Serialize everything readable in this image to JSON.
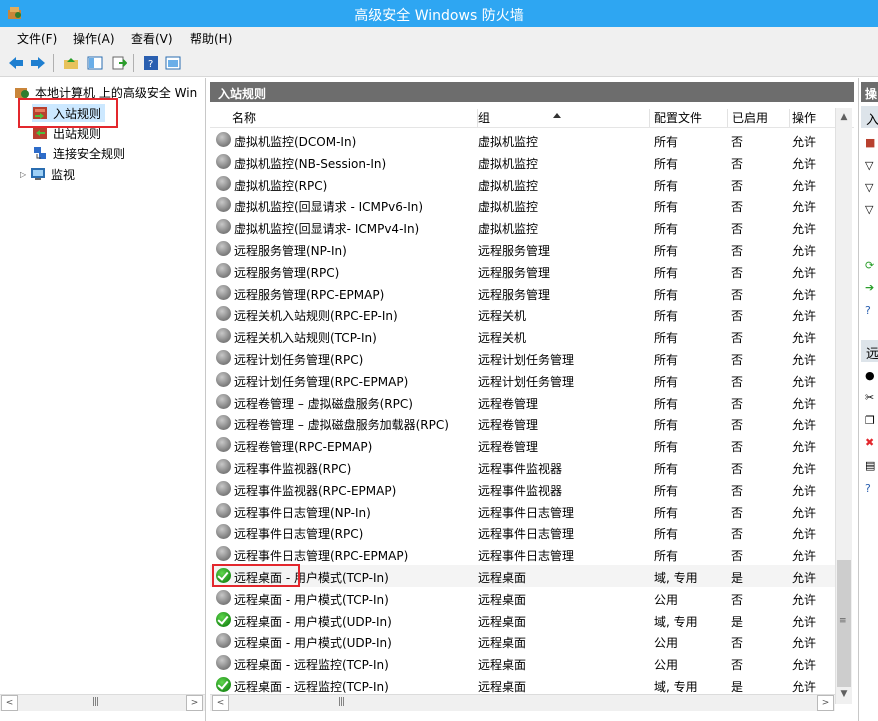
{
  "window": {
    "title": "高级安全 Windows 防火墙"
  },
  "menu": [
    "文件(F)",
    "操作(A)",
    "查看(V)",
    "帮助(H)"
  ],
  "tree": {
    "root": "本地计算机 上的高级安全 Win",
    "items": [
      "入站规则",
      "出站规则",
      "连接安全规则",
      "监视"
    ]
  },
  "main": {
    "header": "入站规则",
    "columns": {
      "name": "名称",
      "group": "组",
      "profile": "配置文件",
      "enabled": "已启用",
      "action": "操作"
    },
    "rows": [
      {
        "name": "虚拟机监控(DCOM-In)",
        "group": "虚拟机监控",
        "profile": "所有",
        "enabled": "否",
        "action": "允许",
        "on": false
      },
      {
        "name": "虚拟机监控(NB-Session-In)",
        "group": "虚拟机监控",
        "profile": "所有",
        "enabled": "否",
        "action": "允许",
        "on": false
      },
      {
        "name": "虚拟机监控(RPC)",
        "group": "虚拟机监控",
        "profile": "所有",
        "enabled": "否",
        "action": "允许",
        "on": false
      },
      {
        "name": "虚拟机监控(回显请求 - ICMPv6-In)",
        "group": "虚拟机监控",
        "profile": "所有",
        "enabled": "否",
        "action": "允许",
        "on": false
      },
      {
        "name": "虚拟机监控(回显请求- ICMPv4-In)",
        "group": "虚拟机监控",
        "profile": "所有",
        "enabled": "否",
        "action": "允许",
        "on": false
      },
      {
        "name": "远程服务管理(NP-In)",
        "group": "远程服务管理",
        "profile": "所有",
        "enabled": "否",
        "action": "允许",
        "on": false
      },
      {
        "name": "远程服务管理(RPC)",
        "group": "远程服务管理",
        "profile": "所有",
        "enabled": "否",
        "action": "允许",
        "on": false
      },
      {
        "name": "远程服务管理(RPC-EPMAP)",
        "group": "远程服务管理",
        "profile": "所有",
        "enabled": "否",
        "action": "允许",
        "on": false
      },
      {
        "name": "远程关机入站规则(RPC-EP-In)",
        "group": "远程关机",
        "profile": "所有",
        "enabled": "否",
        "action": "允许",
        "on": false
      },
      {
        "name": "远程关机入站规则(TCP-In)",
        "group": "远程关机",
        "profile": "所有",
        "enabled": "否",
        "action": "允许",
        "on": false
      },
      {
        "name": "远程计划任务管理(RPC)",
        "group": "远程计划任务管理",
        "profile": "所有",
        "enabled": "否",
        "action": "允许",
        "on": false
      },
      {
        "name": "远程计划任务管理(RPC-EPMAP)",
        "group": "远程计划任务管理",
        "profile": "所有",
        "enabled": "否",
        "action": "允许",
        "on": false
      },
      {
        "name": "远程卷管理 – 虚拟磁盘服务(RPC)",
        "group": "远程卷管理",
        "profile": "所有",
        "enabled": "否",
        "action": "允许",
        "on": false
      },
      {
        "name": "远程卷管理 – 虚拟磁盘服务加载器(RPC)",
        "group": "远程卷管理",
        "profile": "所有",
        "enabled": "否",
        "action": "允许",
        "on": false
      },
      {
        "name": "远程卷管理(RPC-EPMAP)",
        "group": "远程卷管理",
        "profile": "所有",
        "enabled": "否",
        "action": "允许",
        "on": false
      },
      {
        "name": "远程事件监视器(RPC)",
        "group": "远程事件监视器",
        "profile": "所有",
        "enabled": "否",
        "action": "允许",
        "on": false
      },
      {
        "name": "远程事件监视器(RPC-EPMAP)",
        "group": "远程事件监视器",
        "profile": "所有",
        "enabled": "否",
        "action": "允许",
        "on": false
      },
      {
        "name": "远程事件日志管理(NP-In)",
        "group": "远程事件日志管理",
        "profile": "所有",
        "enabled": "否",
        "action": "允许",
        "on": false
      },
      {
        "name": "远程事件日志管理(RPC)",
        "group": "远程事件日志管理",
        "profile": "所有",
        "enabled": "否",
        "action": "允许",
        "on": false
      },
      {
        "name": "远程事件日志管理(RPC-EPMAP)",
        "group": "远程事件日志管理",
        "profile": "所有",
        "enabled": "否",
        "action": "允许",
        "on": false
      },
      {
        "name": "远程桌面 - 用户模式(TCP-In)",
        "group": "远程桌面",
        "profile": "域, 专用",
        "enabled": "是",
        "action": "允许",
        "on": true
      },
      {
        "name": "远程桌面 - 用户模式(TCP-In)",
        "group": "远程桌面",
        "profile": "公用",
        "enabled": "否",
        "action": "允许",
        "on": false
      },
      {
        "name": "远程桌面 - 用户模式(UDP-In)",
        "group": "远程桌面",
        "profile": "域, 专用",
        "enabled": "是",
        "action": "允许",
        "on": true
      },
      {
        "name": "远程桌面 - 用户模式(UDP-In)",
        "group": "远程桌面",
        "profile": "公用",
        "enabled": "否",
        "action": "允许",
        "on": false
      },
      {
        "name": "远程桌面 - 远程监控(TCP-In)",
        "group": "远程桌面",
        "profile": "公用",
        "enabled": "否",
        "action": "允许",
        "on": false
      },
      {
        "name": "远程桌面 - 远程监控(TCP-In)",
        "group": "远程桌面",
        "profile": "域, 专用",
        "enabled": "是",
        "action": "允许",
        "on": true
      }
    ]
  },
  "actions": {
    "header": "操",
    "section1": "入",
    "section2": "远"
  },
  "colors": {
    "titlebar": "#2ea6f2",
    "pane_header": "#6d6d6d",
    "highlight": "#e3272d",
    "enabled_icon": "#2aa52a",
    "disabled_icon": "#8a8a8a"
  }
}
